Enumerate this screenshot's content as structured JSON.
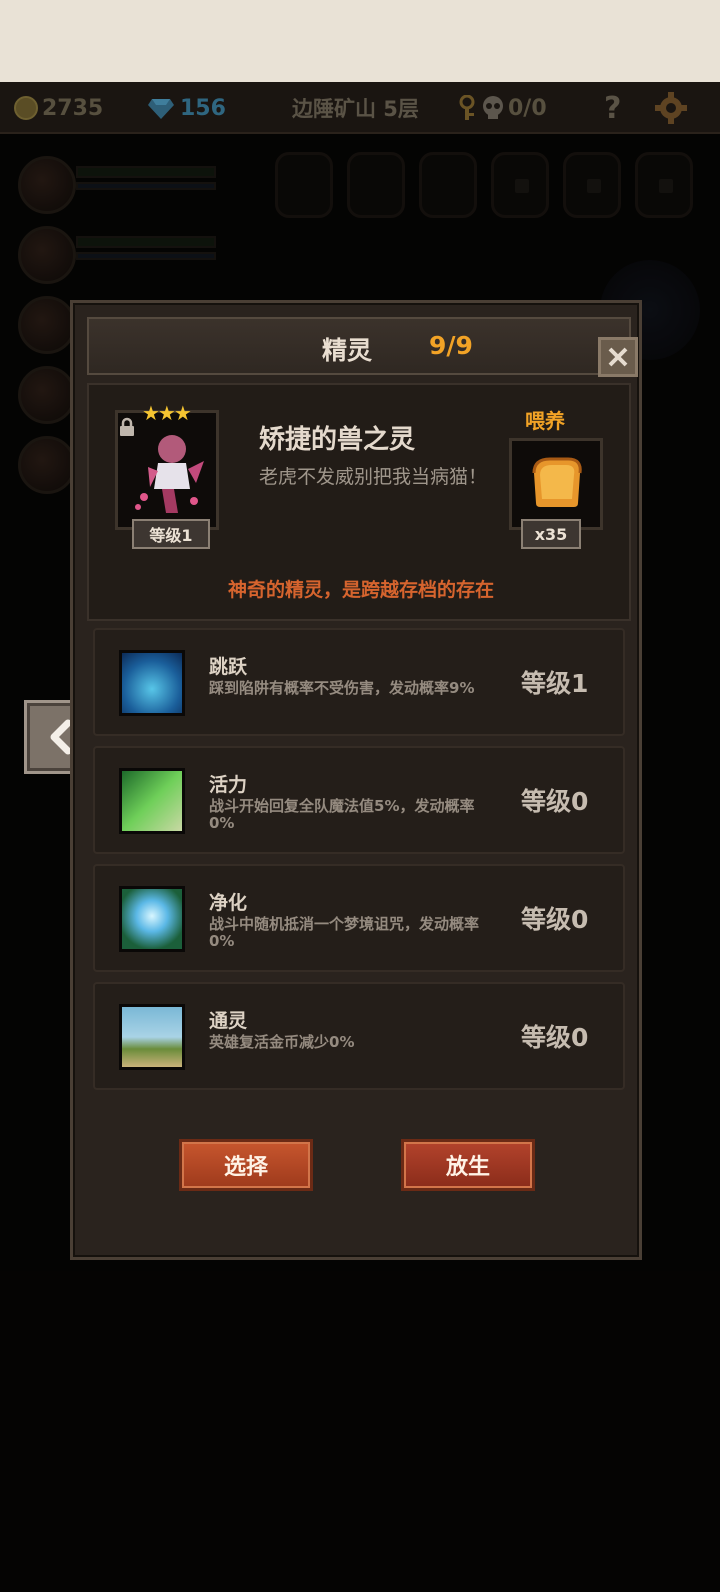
{
  "status_bar": {
    "gold": "2735",
    "gems": "156",
    "location": "边陲矿山 5层",
    "kills": "0/0",
    "help": "?"
  },
  "modal": {
    "title": "精灵",
    "count": "9/9",
    "spirit": {
      "name": "矫捷的兽之灵",
      "description": "老虎不发威别把我当病猫！",
      "stars": "★★★",
      "level": "等级1"
    },
    "feed": {
      "label": "喂养",
      "count": "x35"
    },
    "tagline": "神奇的精灵，是跨越存档的存在",
    "skills": [
      {
        "name": "跳跃",
        "description": "踩到陷阱有概率不受伤害，发动概率9%",
        "level": "等级1",
        "icon": "jump-icon"
      },
      {
        "name": "活力",
        "description": "战斗开始回复全队魔法值5%，发动概率0%",
        "level": "等级0",
        "icon": "vitality-icon"
      },
      {
        "name": "净化",
        "description": "战斗中随机抵消一个梦境诅咒，发动概率0%",
        "level": "等级0",
        "icon": "purify-icon"
      },
      {
        "name": "通灵",
        "description": "英雄复活金币减少0%",
        "level": "等级0",
        "icon": "tombstone-icon"
      }
    ],
    "buttons": {
      "select": "选择",
      "release": "放生"
    }
  }
}
